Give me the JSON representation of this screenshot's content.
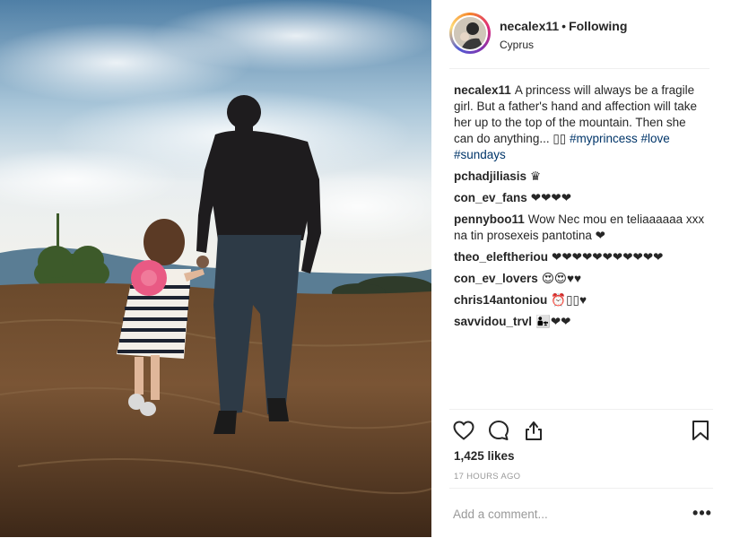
{
  "post": {
    "username": "necalex11",
    "separator": "•",
    "follow_state": "Following",
    "location": "Cyprus",
    "photo_icon": "photo-father-daughter-walking"
  },
  "caption": {
    "username": "necalex11",
    "text": "A princess will always be a fragile girl. But a father's hand and affection will take her up to the top of the mountain. Then she can do anything... ",
    "glyphs": "▯▯",
    "hashtags": [
      "#myprincess",
      "#love",
      "#sundays"
    ]
  },
  "comments": [
    {
      "user": "pchadjiliasis",
      "text": "♛"
    },
    {
      "user": "con_ev_fans",
      "text": "❤❤❤❤"
    },
    {
      "user": "pennyboo11",
      "text": "Wow Nec mou en teliaaaaaa xxx na tin prosexeis pantotina ❤"
    },
    {
      "user": "theo_eleftheriou",
      "text": "❤❤❤❤❤❤❤❤❤❤❤"
    },
    {
      "user": "con_ev_lovers",
      "text": "😍😍♥♥"
    },
    {
      "user": "chris14antoniou",
      "text": "⏰▯▯♥"
    },
    {
      "user": "savvidou_trvl",
      "text": "👨‍👧❤❤"
    }
  ],
  "actions": {
    "like_icon": "heart-outline-icon",
    "comment_icon": "speech-bubble-icon",
    "share_icon": "share-icon",
    "save_icon": "bookmark-icon"
  },
  "likes": "1,425 likes",
  "timestamp": "17 HOURS AGO",
  "add_comment": {
    "placeholder": "Add a comment..."
  },
  "more_label": "•••",
  "colors": {
    "link": "#003569",
    "muted": "#999999",
    "text": "#262626",
    "border": "#efefef"
  }
}
